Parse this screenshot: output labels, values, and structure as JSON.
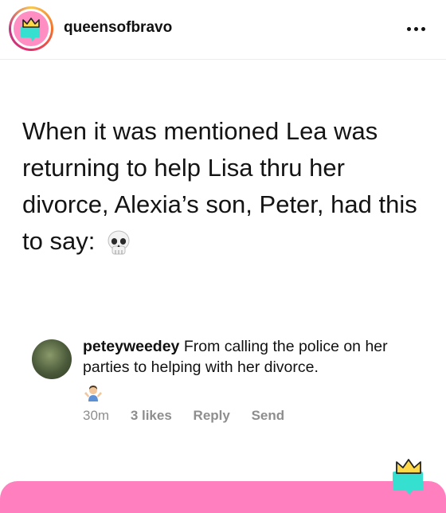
{
  "account": {
    "username": "queensofbravo"
  },
  "post": {
    "caption": "When it was mentioned Lea was returning to help Lisa thru her divorce, Alexia’s son, Peter, had this to say:",
    "caption_emoji_icon": "skull-icon"
  },
  "comment": {
    "username": "peteyweedey",
    "text": "From calling the police on her parties to helping with her divorce.",
    "emoji_icon": "man-shrugging-icon",
    "time": "30m",
    "likes": "3 likes",
    "reply_label": "Reply",
    "send_label": "Send"
  },
  "colors": {
    "brand_pink": "#ff7fbf",
    "brand_teal": "#35e0d0",
    "crown_yellow": "#ffd84a",
    "meta_gray": "#8e8e8e"
  }
}
